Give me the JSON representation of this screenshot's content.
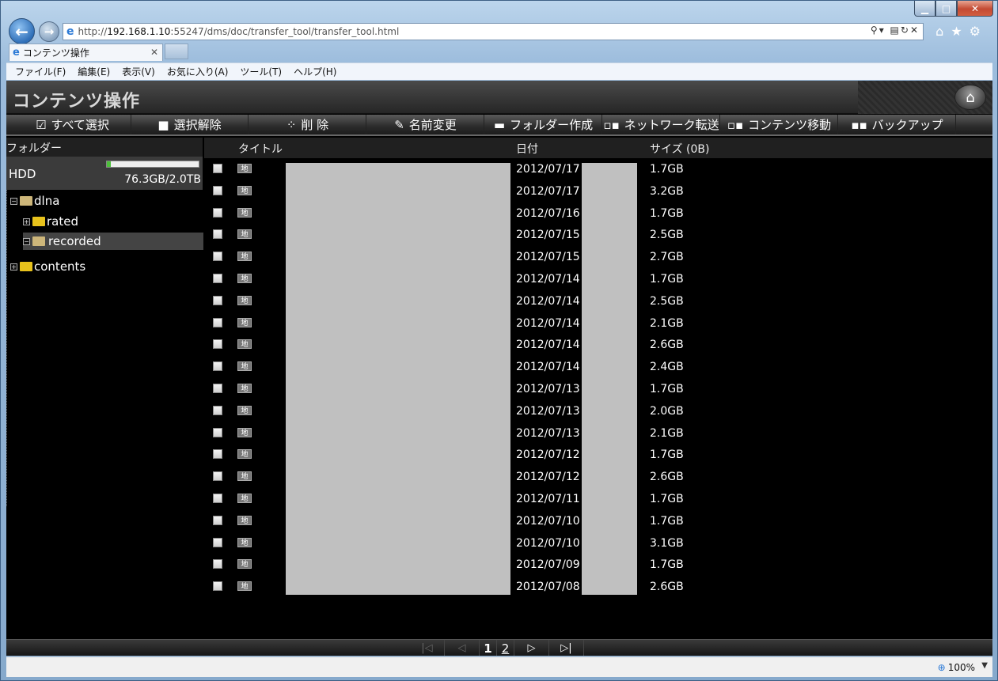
{
  "browser": {
    "url_prefix": "http://",
    "url_host": "192.168.1.10",
    "url_rest": ":55247/dms/doc/transfer_tool/transfer_tool.html",
    "tab_title": "コンテンツ操作",
    "menu": [
      "ファイル(F)",
      "編集(E)",
      "表示(V)",
      "お気に入り(A)",
      "ツール(T)",
      "ヘルプ(H)"
    ],
    "zoom": "100%"
  },
  "app": {
    "title": "コンテンツ操作",
    "toolbar": [
      {
        "label": "すべて選択",
        "icon": "checkbox-checked-icon"
      },
      {
        "label": "選択解除",
        "icon": "checkbox-empty-icon"
      },
      {
        "label": "削 除",
        "icon": "spinner-icon"
      },
      {
        "label": "名前変更",
        "icon": "pencil-icon"
      },
      {
        "label": "フォルダー作成",
        "icon": "folder-icon"
      },
      {
        "label": "ネットワーク転送",
        "icon": "transfer-icon"
      },
      {
        "label": "コンテンツ移動",
        "icon": "move-icon"
      },
      {
        "label": "バックアップ",
        "icon": "backup-icon"
      }
    ]
  },
  "folders": {
    "header": "フォルダー",
    "hdd_label": "HDD",
    "hdd_capacity": "76.3GB/2.0TB",
    "hdd_usage_fraction": 0.04,
    "tree": [
      "dlna",
      "rated",
      "recorded",
      "contents"
    ]
  },
  "table": {
    "col_title": "タイトル",
    "col_date": "日付",
    "col_size": "サイズ (0B)",
    "rows": [
      {
        "date": "2012/07/17",
        "size": "1.7GB"
      },
      {
        "date": "2012/07/17",
        "size": "3.2GB"
      },
      {
        "date": "2012/07/16",
        "size": "1.7GB"
      },
      {
        "date": "2012/07/15",
        "size": "2.5GB"
      },
      {
        "date": "2012/07/15",
        "size": "2.7GB"
      },
      {
        "date": "2012/07/14",
        "size": "1.7GB"
      },
      {
        "date": "2012/07/14",
        "size": "2.5GB"
      },
      {
        "date": "2012/07/14",
        "size": "2.1GB"
      },
      {
        "date": "2012/07/14",
        "size": "2.6GB"
      },
      {
        "date": "2012/07/14",
        "size": "2.4GB"
      },
      {
        "date": "2012/07/13",
        "size": "1.7GB"
      },
      {
        "date": "2012/07/13",
        "size": "2.0GB"
      },
      {
        "date": "2012/07/13",
        "size": "2.1GB"
      },
      {
        "date": "2012/07/12",
        "size": "1.7GB"
      },
      {
        "date": "2012/07/12",
        "size": "2.6GB"
      },
      {
        "date": "2012/07/11",
        "size": "1.7GB"
      },
      {
        "date": "2012/07/10",
        "size": "1.7GB"
      },
      {
        "date": "2012/07/10",
        "size": "3.1GB"
      },
      {
        "date": "2012/07/09",
        "size": "1.7GB"
      },
      {
        "date": "2012/07/08",
        "size": "2.6GB"
      }
    ],
    "row_icon_text": "地"
  },
  "pager": {
    "pages": [
      "1",
      "2"
    ]
  }
}
